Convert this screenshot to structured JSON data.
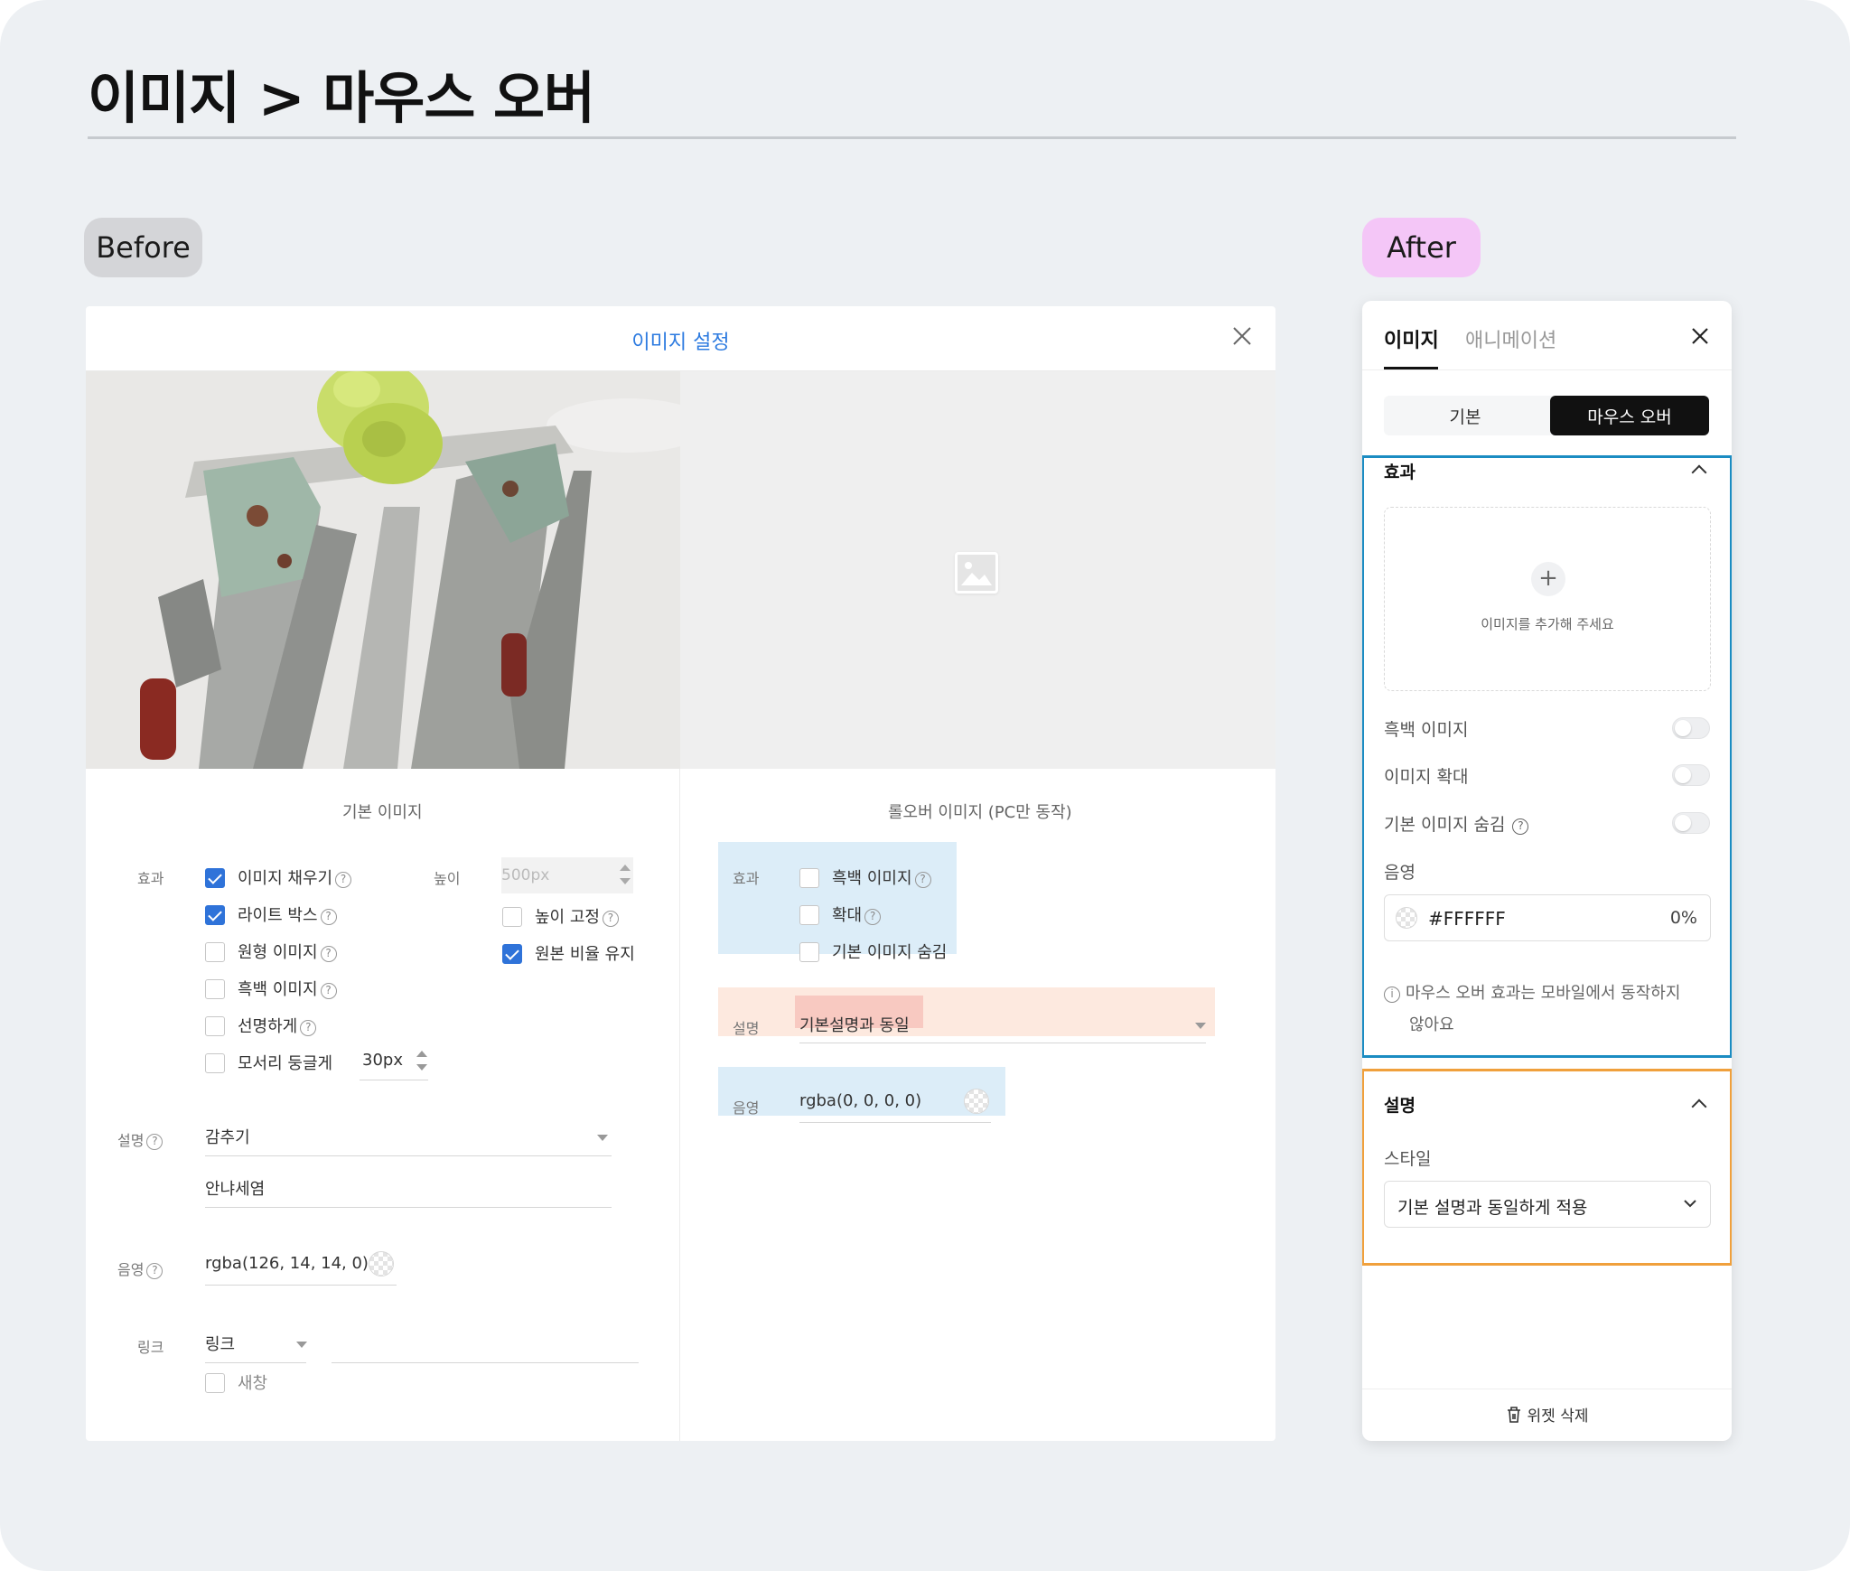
{
  "page": {
    "title": "이미지 > 마우스 오버",
    "before_label": "Before",
    "after_label": "After"
  },
  "before": {
    "dialog_title": "이미지 설정",
    "basic_caption": "기본 이미지",
    "rollover_caption": "롤오버 이미지 (PC만 동작)",
    "basic": {
      "effect_label": "효과",
      "effects": [
        {
          "label": "이미지 채우기",
          "checked": true
        },
        {
          "label": "라이트 박스",
          "checked": true
        },
        {
          "label": "원형 이미지",
          "checked": false
        },
        {
          "label": "흑백 이미지",
          "checked": false
        },
        {
          "label": "선명하게",
          "checked": false
        },
        {
          "label": "모서리 둥글게",
          "checked": false
        }
      ],
      "corner_value": "30px",
      "height_label": "높이",
      "height_placeholder": "500px",
      "fix_height_label": "높이 고정",
      "keep_ratio_label": "원본 비율 유지",
      "desc_label": "설명",
      "desc_select": "감추기",
      "desc_text": "안냐세염",
      "shadow_label": "음영",
      "shadow_value": "rgba(126, 14, 14, 0)",
      "link_label": "링크",
      "link_select": "링크",
      "new_window_label": "새창"
    },
    "rollover": {
      "effect_label": "효과",
      "effects": [
        {
          "label": "흑백 이미지",
          "checked": false
        },
        {
          "label": "확대",
          "checked": false
        },
        {
          "label": "기본 이미지 숨김",
          "checked": false
        }
      ],
      "desc_label": "설명",
      "desc_select": "기본설명과 동일",
      "shadow_label": "음영",
      "shadow_value": "rgba(0, 0, 0, 0)"
    }
  },
  "after": {
    "tabs": [
      "이미지",
      "애니메이션"
    ],
    "segments": [
      "기본",
      "마우스 오버"
    ],
    "effect_title": "효과",
    "dropzone_text": "이미지를 추가해 주세요",
    "toggles": [
      "흑백 이미지",
      "이미지 확대",
      "기본 이미지 숨김"
    ],
    "shadow_label": "음영",
    "shadow_color": "#FFFFFF",
    "shadow_opacity": "0%",
    "notice_line1": "마우스 오버 효과는 모바일에서 동작하지",
    "notice_line2": "않아요",
    "desc_title": "설명",
    "style_label": "스타일",
    "style_value": "기본 설명과 동일하게 적용",
    "delete_label": "위젯 삭제"
  },
  "colors": {
    "accent_blue": "#2f73d9",
    "title_blue": "#2d7be0",
    "highlight_blue": "#1b8cc2",
    "highlight_orange": "#f0a03c",
    "after_pill": "#f4c6f7"
  }
}
